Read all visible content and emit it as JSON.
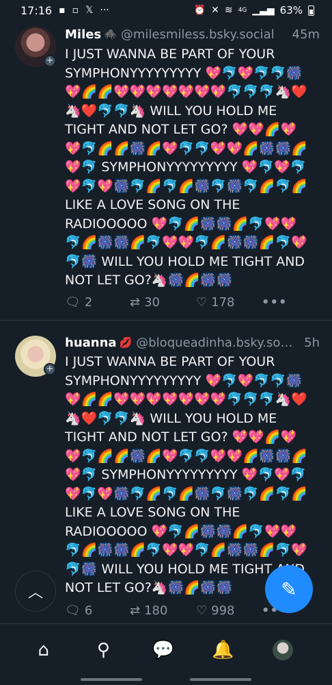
{
  "status_bar": {
    "time": "17:16",
    "battery": "63%",
    "network": "4G",
    "left_icons": [
      "message-icon",
      "twitch-icon",
      "x-icon",
      "more-icon"
    ],
    "right_icons": [
      "alarm-icon",
      "mute-icon",
      "wifi-icon",
      "signal-icon",
      "battery-icon"
    ]
  },
  "posts": [
    {
      "name": "Miles",
      "name_emoji": "🕷️",
      "handle": "@milesmiless.bsky.social",
      "time": "45m",
      "text": "I JUST WANNA BE PART OF YOUR SYMPHONYYYYYYYYY 💖🐬💖🐬🐬🎆💖🌈🌈💖💖💖💖💖💖💖🐬🐬🐬🦄❤️🦄❤️🐬🐬🦄 WILL YOU HOLD ME TIGHT AND NOT LET GO? 💖💖🌈💖💖🐬🌈🌈🎆🌈💖🐬🐬💖💖🌈🎆🎆🌈💖🐬 SYMPHONYYYYYYYYY 💖🐬💖🐬💖🐬💖🎆🐬🌈🐬🌈🎆🐬🎆🐬🌈🐬🌈 LIKE A LOVE SONG ON THE RADIOOOOO 💖🐬🌈🎆🎆🌈🐬💖💖🐬🌈🎆🎆🌈🐬💖💖🐬🌈🎆🎆🌈🐬💖🐬🎆 WILL YOU HOLD ME TIGHT AND NOT LET GO?🦄🎆🌈🎆🎆",
      "replies": "2",
      "reposts": "30",
      "likes": "178"
    },
    {
      "name": "huanna",
      "name_emoji": "💋",
      "handle": "@bloqueadinha.bsky.soc...",
      "time": "5h",
      "text": "I JUST WANNA BE PART OF YOUR SYMPHONYYYYYYYYY 💖🐬💖🐬🐬🎆💖🌈🌈💖💖💖💖💖💖💖🐬🐬🐬🦄❤️🦄❤️🐬🐬🦄 WILL YOU HOLD ME TIGHT AND NOT LET GO? 💖💖🌈💖💖🐬🌈🌈🎆🌈💖🐬🐬💖💖🌈🎆🎆🌈💖🐬 SYMPHONYYYYYYYYY 💖🐬💖🐬💖🐬💖🎆🐬🌈🐬🌈🎆🐬🎆🐬🌈🐬🌈 LIKE A LOVE SONG ON THE RADIOOOOO 💖🐬🌈🎆🎆🌈🐬💖💖🐬🌈🎆🎆🌈🐬💖💖🐬🌈🎆🎆🌈🐬💖🐬🎆 WILL YOU HOLD ME TIGHT AND NOT LET GO?🦄🎆🌈🎆🎆",
      "replies": "6",
      "reposts": "180",
      "likes": "998"
    }
  ],
  "glyphs": {
    "plus": "+",
    "reply": "🗨",
    "repost": "⇄",
    "like": "♡",
    "more": "•••",
    "scroll_top": "︿",
    "compose": "✎",
    "home": "⌂",
    "search": "⚲",
    "chat": "💬",
    "notifications": "🔔"
  },
  "bottom_nav": [
    "home",
    "search",
    "chat",
    "notifications",
    "profile"
  ],
  "colors": {
    "background": "#161e27",
    "accent": "#208bfe",
    "muted": "#8b98a5"
  }
}
